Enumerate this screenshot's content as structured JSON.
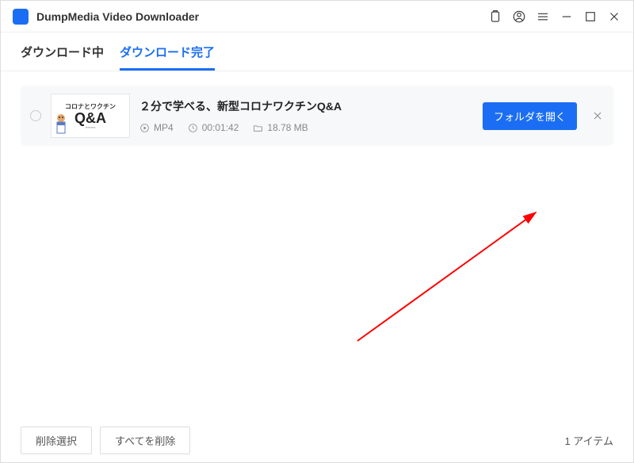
{
  "app": {
    "title": "DumpMedia Video Downloader"
  },
  "tabs": {
    "downloading": "ダウンロード中",
    "completed": "ダウンロード完了"
  },
  "items": [
    {
      "title": "２分で学べる、新型コロナワクチンQ&A",
      "format": "MP4",
      "duration": "00:01:42",
      "size": "18.78 MB",
      "thumb_top": "コロナとワクチン",
      "thumb_qa": "Q&A",
      "action": "フォルダを開く"
    }
  ],
  "footer": {
    "delete_selected": "削除選択",
    "delete_all": "すべてを削除",
    "count": "1 アイテム"
  }
}
